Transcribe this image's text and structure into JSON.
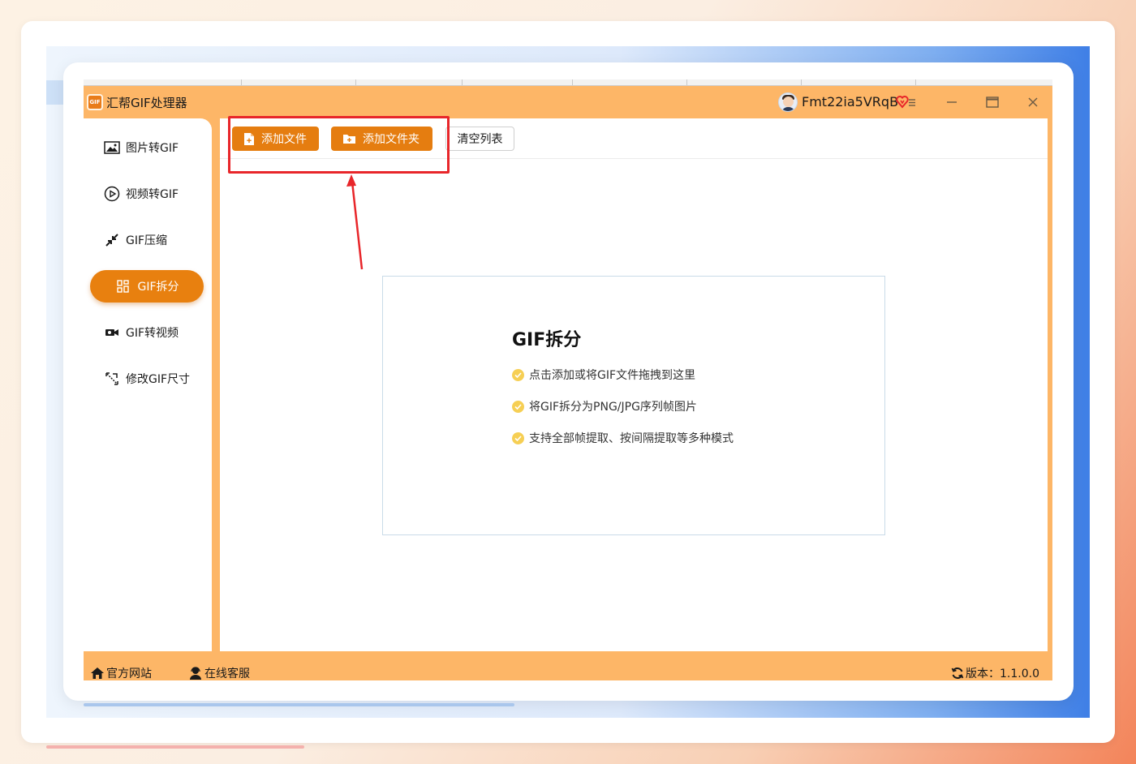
{
  "app": {
    "logo_text": "GIF",
    "title": "汇帮GIF处理器",
    "username": "Fmt22ia5VRqB",
    "accent_color": "#e8800f",
    "frame_color": "#fdb667"
  },
  "sidebar": {
    "items": [
      {
        "label": "图片转GIF",
        "icon": "image-icon",
        "active": false
      },
      {
        "label": "视频转GIF",
        "icon": "play-circle-icon",
        "active": false
      },
      {
        "label": "GIF压缩",
        "icon": "compress-arrows-icon",
        "active": false
      },
      {
        "label": "GIF拆分",
        "icon": "grid-split-icon",
        "active": true
      },
      {
        "label": "GIF转视频",
        "icon": "video-camera-icon",
        "active": false
      },
      {
        "label": "修改GIF尺寸",
        "icon": "resize-icon",
        "active": false
      }
    ]
  },
  "toolbar": {
    "add_file_label": "添加文件",
    "add_folder_label": "添加文件夹",
    "clear_list_label": "清空列表"
  },
  "dropzone": {
    "title": "GIF拆分",
    "features": [
      "点击添加或将GIF文件拖拽到这里",
      "将GIF拆分为PNG/JPG序列帧图片",
      "支持全部帧提取、按间隔提取等多种模式"
    ]
  },
  "footer": {
    "official_site_label": "官方网站",
    "online_service_label": "在线客服",
    "version_label": "版本：1.1.0.0"
  }
}
